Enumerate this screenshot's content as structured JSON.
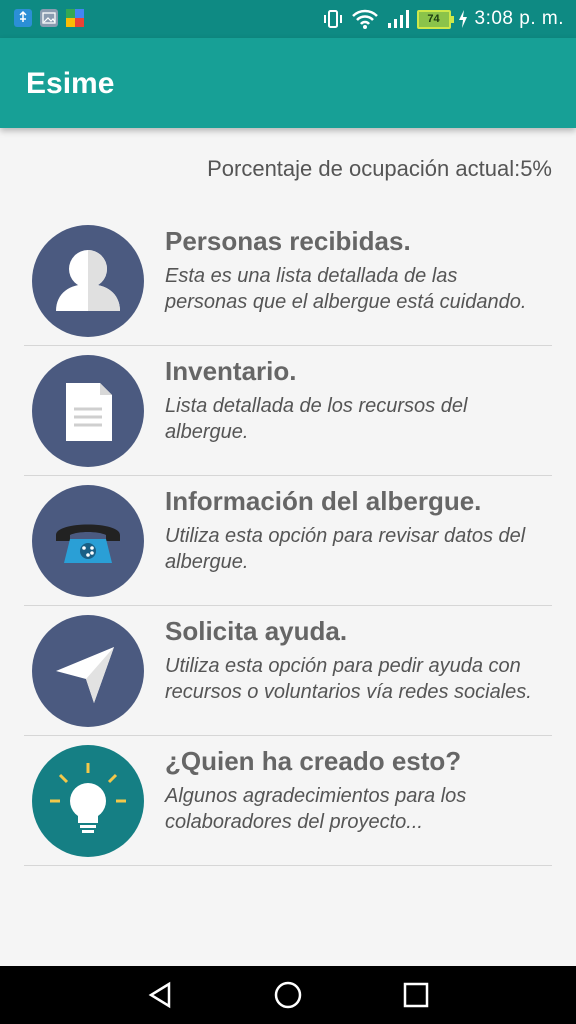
{
  "status_bar": {
    "time": "3:08 p. m.",
    "battery": "74",
    "icons": [
      "usb-icon",
      "image-icon",
      "maps-icon",
      "vibrate-icon",
      "wifi-icon",
      "signal-icon",
      "charging-icon"
    ]
  },
  "app_bar": {
    "title": "Esime"
  },
  "occupancy_text": "Porcentaje de ocupación actual:5%",
  "menu": [
    {
      "title": "Personas recibidas.",
      "description": "Esta es una lista detallada de las personas que el albergue está cuidando.",
      "icon": "person-icon"
    },
    {
      "title": "Inventario.",
      "description": "Lista detallada de los recursos del albergue.",
      "icon": "document-icon"
    },
    {
      "title": "Información del albergue.",
      "description": "Utiliza esta opción para revisar datos del albergue.",
      "icon": "telephone-icon"
    },
    {
      "title": "Solicita ayuda.",
      "description": "Utiliza esta opción para pedir ayuda con recursos o voluntarios vía redes sociales.",
      "icon": "send-icon"
    },
    {
      "title": "¿Quien ha creado esto?",
      "description": "Algunos agradecimientos para los colaboradores del proyecto...",
      "icon": "lightbulb-icon"
    }
  ],
  "nav_bar": {
    "buttons": [
      "back-icon",
      "home-icon",
      "recents-icon"
    ]
  },
  "colors": {
    "status_bar": "#0e8a83",
    "app_bar": "#17a096",
    "icon_circle": "#4b5a80",
    "bulb_circle": "#157f84"
  }
}
